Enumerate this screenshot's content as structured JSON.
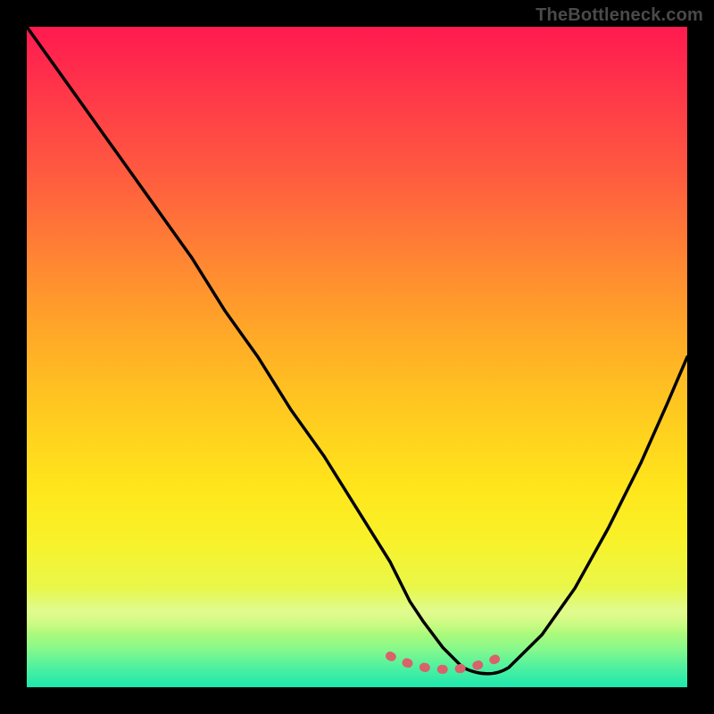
{
  "watermark": "TheBottleneck.com",
  "chart_data": {
    "type": "line",
    "title": "",
    "xlabel": "",
    "ylabel": "",
    "xlim": [
      0,
      100
    ],
    "ylim": [
      0,
      100
    ],
    "grid": false,
    "legend": null,
    "series": [
      {
        "name": "bottleneck-curve",
        "x": [
          0,
          5,
          10,
          15,
          20,
          25,
          30,
          35,
          40,
          45,
          50,
          55,
          58,
          60,
          63,
          66,
          70,
          73,
          78,
          83,
          88,
          93,
          97,
          100
        ],
        "values": [
          100,
          93,
          86,
          79,
          72,
          65,
          57,
          50,
          42,
          35,
          27,
          19,
          13,
          10,
          6,
          3,
          2,
          3,
          8,
          15,
          24,
          34,
          43,
          50
        ]
      }
    ],
    "highlight_range_x": [
      55,
      72
    ],
    "background_gradient": {
      "top_color": "#ff1a4f",
      "mid_color": "#ffe61c",
      "bottom_color": "#1de7ae"
    },
    "curve_min_x": 69,
    "curve_min_y": 2
  }
}
